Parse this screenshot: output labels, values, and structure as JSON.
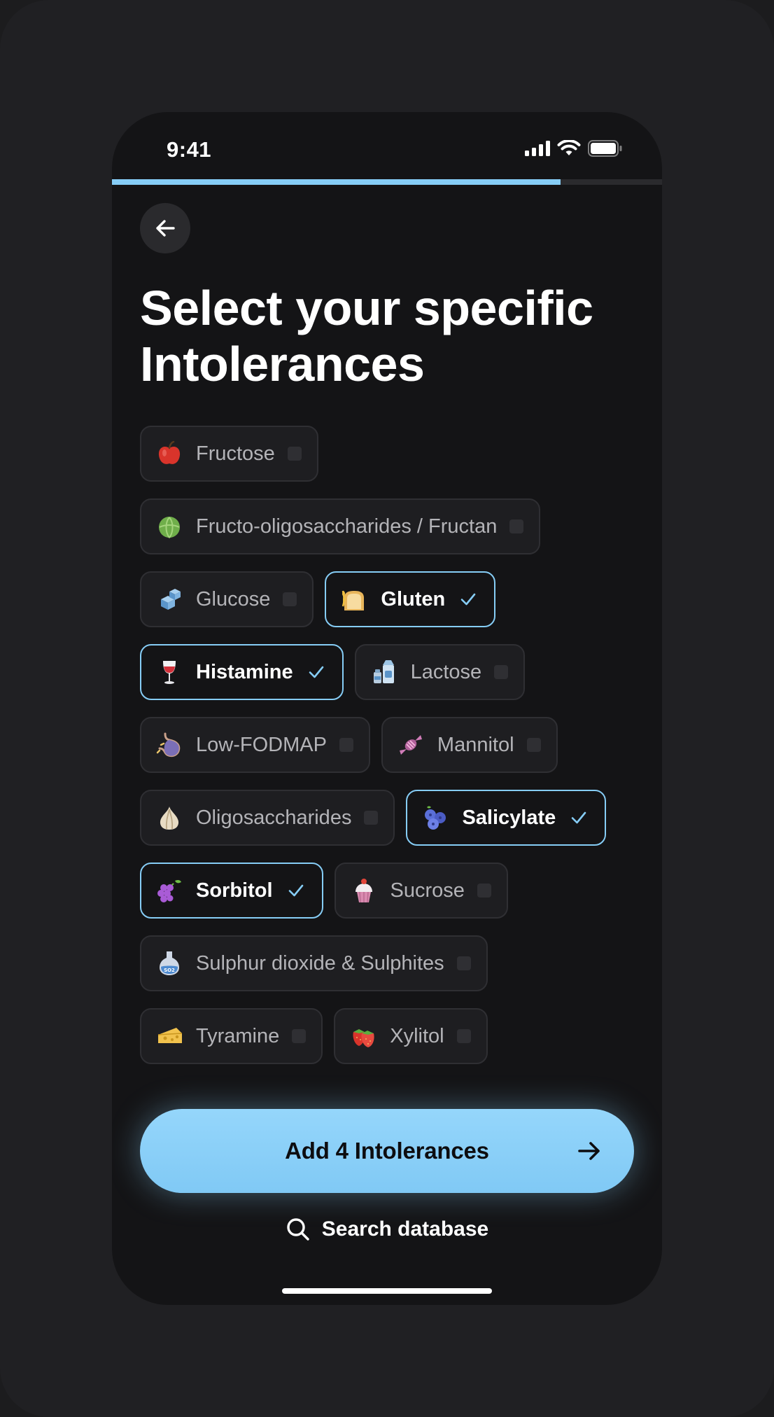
{
  "status_bar": {
    "time": "9:41"
  },
  "progress": {
    "fraction": 0.815
  },
  "header": {
    "title_line1": "Select your specific",
    "title_line2": "Intolerances"
  },
  "intolerances": [
    {
      "label": "Fructose",
      "icon": "apple-icon",
      "selected": false
    },
    {
      "label": "Fructo-oligosaccharides / Fructan",
      "icon": "cabbage-icon",
      "selected": false
    },
    {
      "label": "Glucose",
      "icon": "sugar-cubes-icon",
      "selected": false
    },
    {
      "label": "Gluten",
      "icon": "bread-wheat-icon",
      "selected": true
    },
    {
      "label": "Histamine",
      "icon": "wine-glass-icon",
      "selected": true
    },
    {
      "label": "Lactose",
      "icon": "milk-carton-icon",
      "selected": false
    },
    {
      "label": "Low-FODMAP",
      "icon": "stomach-icon",
      "selected": false
    },
    {
      "label": "Mannitol",
      "icon": "candy-icon",
      "selected": false
    },
    {
      "label": "Oligosaccharides",
      "icon": "garlic-icon",
      "selected": false
    },
    {
      "label": "Salicylate",
      "icon": "blueberries-icon",
      "selected": true
    },
    {
      "label": "Sorbitol",
      "icon": "grapes-icon",
      "selected": true
    },
    {
      "label": "Sucrose",
      "icon": "cupcake-icon",
      "selected": false
    },
    {
      "label": "Sulphur dioxide & Sulphites",
      "icon": "flask-icon",
      "selected": false
    },
    {
      "label": "Tyramine",
      "icon": "cheese-icon",
      "selected": false
    },
    {
      "label": "Xylitol",
      "icon": "strawberries-icon",
      "selected": false
    }
  ],
  "cta": {
    "label": "Add 4 Intolerances"
  },
  "search": {
    "label": "Search database"
  },
  "colors": {
    "accent": "#86cdf6",
    "background": "#141416",
    "chip_border": "#2f2f33"
  }
}
